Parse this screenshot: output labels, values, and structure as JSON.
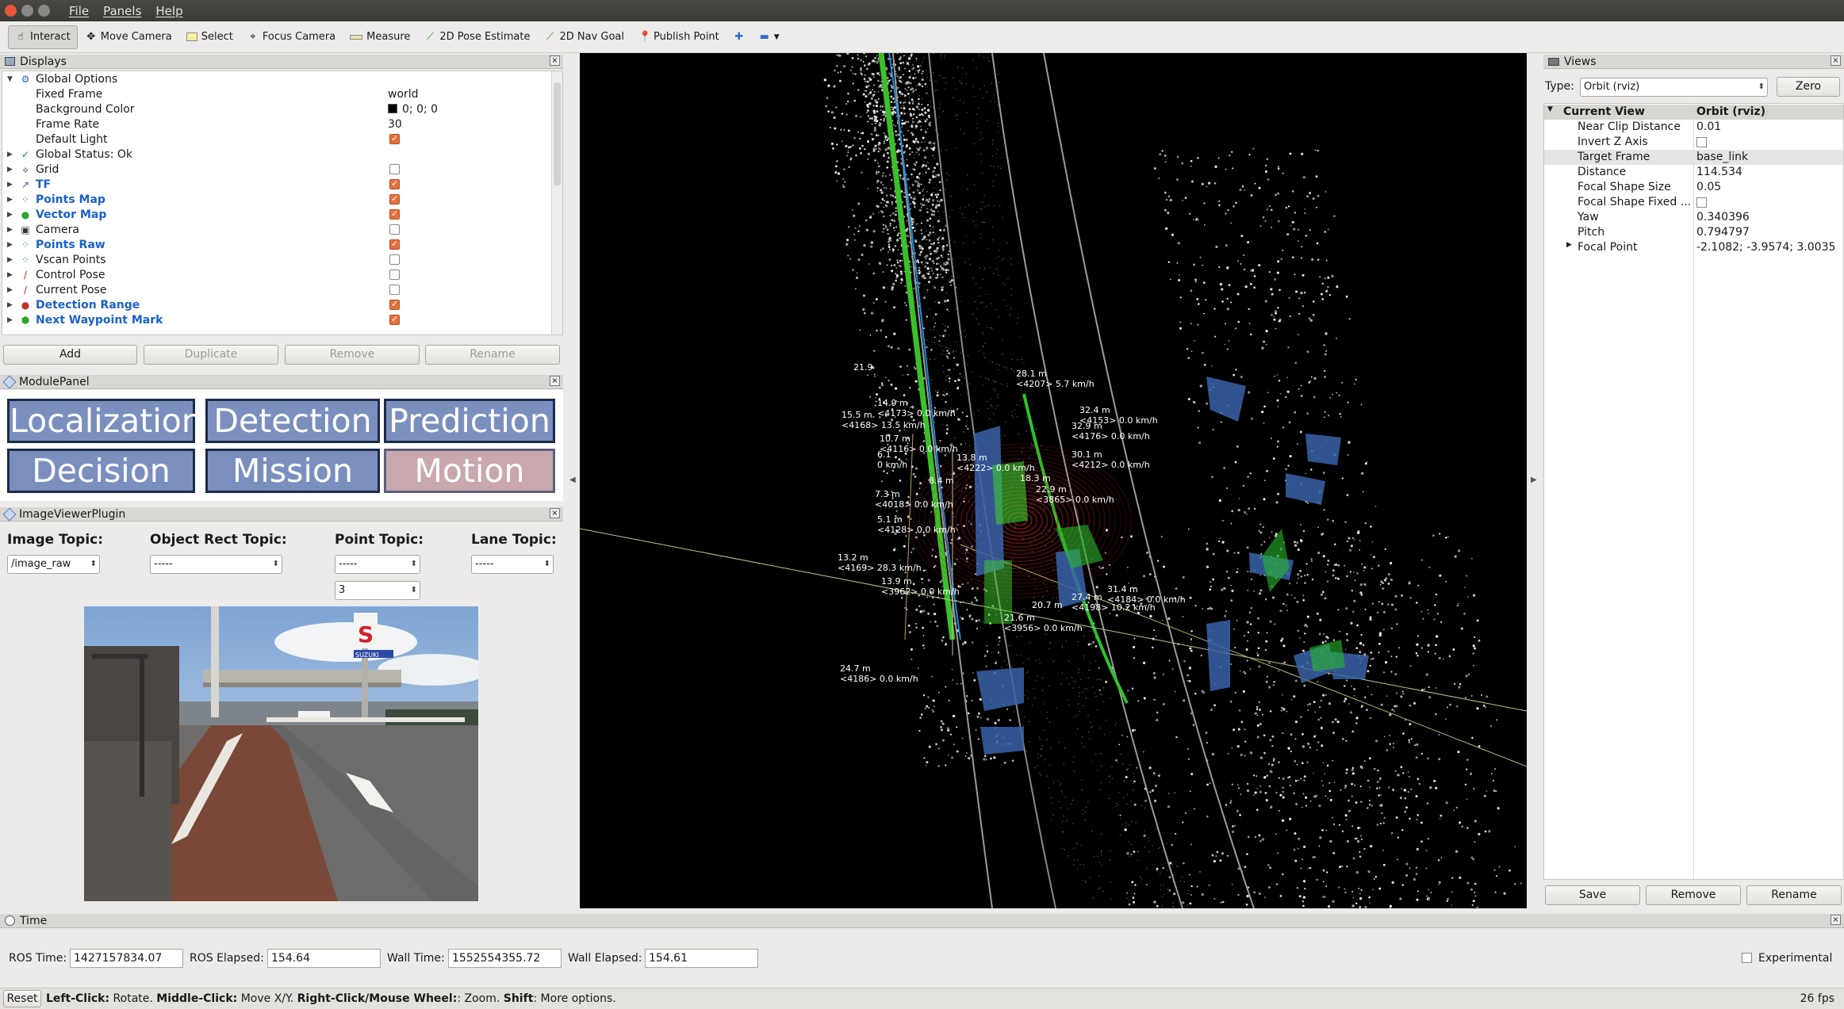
{
  "window": {
    "menus": [
      "File",
      "Panels",
      "Help"
    ]
  },
  "toolbar": {
    "tools": [
      {
        "label": "Interact",
        "icon": "hand-icon"
      },
      {
        "label": "Move Camera",
        "icon": "move-icon"
      },
      {
        "label": "Select",
        "icon": "select-box-icon"
      },
      {
        "label": "Focus Camera",
        "icon": "focus-icon"
      },
      {
        "label": "Measure",
        "icon": "ruler-icon"
      },
      {
        "label": "2D Pose Estimate",
        "icon": "pose-arrow-icon"
      },
      {
        "label": "2D Nav Goal",
        "icon": "nav-arrow-icon"
      },
      {
        "label": "Publish Point",
        "icon": "pin-icon"
      }
    ]
  },
  "displays": {
    "title": "Displays",
    "rows": [
      {
        "label": "Global Options",
        "value": ""
      },
      {
        "label": "Fixed Frame",
        "value": "world"
      },
      {
        "label": "Background Color",
        "value": "0; 0; 0"
      },
      {
        "label": "Frame Rate",
        "value": "30"
      },
      {
        "label": "Default Light",
        "value": ""
      },
      {
        "label": "Global Status: Ok",
        "value": ""
      },
      {
        "label": "Grid",
        "value": ""
      },
      {
        "label": "TF",
        "value": ""
      },
      {
        "label": "Points Map",
        "value": ""
      },
      {
        "label": "Vector Map",
        "value": ""
      },
      {
        "label": "Camera",
        "value": ""
      },
      {
        "label": "Points Raw",
        "value": ""
      },
      {
        "label": "Vscan Points",
        "value": ""
      },
      {
        "label": "Control Pose",
        "value": ""
      },
      {
        "label": "Current Pose",
        "value": ""
      },
      {
        "label": "Detection Range",
        "value": ""
      },
      {
        "label": "Next Waypoint Mark",
        "value": ""
      }
    ],
    "buttons": {
      "add": "Add",
      "duplicate": "Duplicate",
      "remove": "Remove",
      "rename": "Rename"
    }
  },
  "module_panel": {
    "title": "ModulePanel",
    "modules": [
      "Localization",
      "Detection",
      "Prediction",
      "Decision",
      "Mission",
      "Motion"
    ]
  },
  "image_viewer": {
    "title": "ImageViewerPlugin",
    "image_topic_label": "Image Topic:",
    "image_topic": "/image_raw",
    "object_rect_label": "Object Rect Topic:",
    "object_rect": "-----",
    "point_topic_label": "Point Topic:",
    "point_topic": "-----",
    "point_size": "3",
    "lane_topic_label": "Lane Topic:",
    "lane_topic": "-----",
    "sign_text": "SUZUKI"
  },
  "views": {
    "title": "Views",
    "type_label": "Type:",
    "type_value": "Orbit (rviz)",
    "zero": "Zero",
    "current_view": "Current View",
    "current_view_value": "Orbit (rviz)",
    "props": [
      {
        "label": "Near Clip Distance",
        "value": "0.01"
      },
      {
        "label": "Invert Z Axis",
        "value": ""
      },
      {
        "label": "Target Frame",
        "value": "base_link"
      },
      {
        "label": "Distance",
        "value": "114.534"
      },
      {
        "label": "Focal Shape Size",
        "value": "0.05"
      },
      {
        "label": "Focal Shape Fixed ...",
        "value": ""
      },
      {
        "label": "Yaw",
        "value": "0.340396"
      },
      {
        "label": "Pitch",
        "value": "0.794797"
      },
      {
        "label": "Focal Point",
        "value": "-2.1082; -3.9574; 3.0035"
      }
    ],
    "buttons": {
      "save": "Save",
      "remove": "Remove",
      "rename": "Rename"
    }
  },
  "objects": [
    {
      "dist": "21.9",
      "id": "",
      "speed": ""
    },
    {
      "dist": "15.5 m",
      "id": "<4168>",
      "speed": "13.5 km/h"
    },
    {
      "dist": "14.9 m",
      "id": "<4173>",
      "speed": "0.0 km/h"
    },
    {
      "dist": "10.7 m",
      "id": "<4116>",
      "speed": "0.0 km/h"
    },
    {
      "dist": "6.1",
      "id": "",
      "speed": "0 km/h"
    },
    {
      "dist": "7.3 m",
      "id": "<4018>",
      "speed": "0.0 km/h"
    },
    {
      "dist": "5.1 m",
      "id": "<4128>",
      "speed": "0.0 km/h"
    },
    {
      "dist": "13.2  m",
      "id": "<4169>",
      "speed": "28.3  km/h"
    },
    {
      "dist": "13.9  m",
      "id": "<3962>",
      "speed": "0.0  km/h"
    },
    {
      "dist": "24.7  m",
      "id": "<4186>",
      "speed": "0.0  km/h"
    },
    {
      "dist": "13.8  m",
      "id": "<4222>",
      "speed": "0.0  km/h"
    },
    {
      "dist": "28.1  m",
      "id": "<4207>",
      "speed": "5.7  km/h"
    },
    {
      "dist": "32.4  m",
      "id": "<4153>",
      "speed": "0.0  km/h"
    },
    {
      "dist": "32.9  m",
      "id": "<4176>",
      "speed": "0.0  km/h"
    },
    {
      "dist": "30.1  m",
      "id": "<4212>",
      "speed": "0.0  km/h"
    },
    {
      "dist": "22.9  m",
      "id": "<3865>",
      "speed": "0.0  km/h"
    },
    {
      "dist": "18.3  m",
      "id": "",
      "speed": ""
    },
    {
      "dist": "8.4  m",
      "id": "",
      "speed": ""
    },
    {
      "dist": "21.6  m",
      "id": "<3956>",
      "speed": "0.0  km/h"
    },
    {
      "dist": "20.7  m",
      "id": "",
      "speed": ""
    },
    {
      "dist": "27.4  m",
      "id": "<4198>",
      "speed": "10.2  km/h"
    },
    {
      "dist": "31.4  m",
      "id": "<4184>",
      "speed": "0.0  km/h"
    }
  ],
  "time": {
    "title": "Time",
    "ros_time_label": "ROS Time:",
    "ros_time": "1427157834.07",
    "ros_elapsed_label": "ROS Elapsed:",
    "ros_elapsed": "154.64",
    "wall_time_label": "Wall Time:",
    "wall_time": "1552554355.72",
    "wall_elapsed_label": "Wall Elapsed:",
    "wall_elapsed": "154.61",
    "experimental": "Experimental"
  },
  "status": {
    "reset": "Reset",
    "hint_b1": "Left-Click:",
    "hint_t1": " Rotate. ",
    "hint_b2": "Middle-Click:",
    "hint_t2": " Move X/Y. ",
    "hint_b3": "Right-Click/Mouse Wheel:",
    "hint_t3": ": Zoom. ",
    "hint_b4": "Shift",
    "hint_t4": ": More options.",
    "fps": "26 fps"
  }
}
